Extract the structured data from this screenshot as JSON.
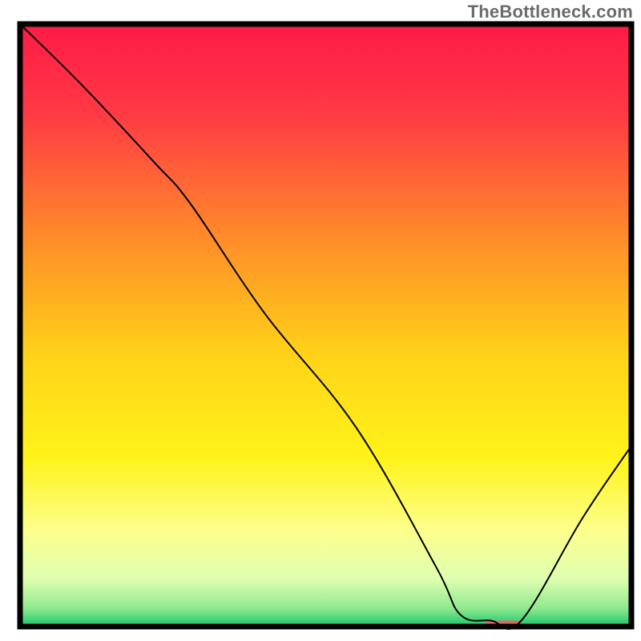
{
  "watermark": "TheBottleneck.com",
  "chart_data": {
    "type": "line",
    "title": "",
    "xlabel": "",
    "ylabel": "",
    "xlim": [
      0,
      100
    ],
    "ylim": [
      0,
      100
    ],
    "grid": false,
    "legend": false,
    "background_gradient_stops": [
      {
        "offset": 0.0,
        "color": "#ff1a48"
      },
      {
        "offset": 0.15,
        "color": "#ff3a44"
      },
      {
        "offset": 0.35,
        "color": "#ff8a2a"
      },
      {
        "offset": 0.55,
        "color": "#ffd318"
      },
      {
        "offset": 0.72,
        "color": "#fff31a"
      },
      {
        "offset": 0.84,
        "color": "#fdff8c"
      },
      {
        "offset": 0.92,
        "color": "#e0ffb0"
      },
      {
        "offset": 0.97,
        "color": "#8fe98f"
      },
      {
        "offset": 1.0,
        "color": "#17c56a"
      }
    ],
    "series": [
      {
        "name": "curve",
        "color": "#000000",
        "stroke_width": 2,
        "x": [
          0,
          10,
          22,
          28,
          40,
          55,
          68,
          72,
          77,
          82,
          92,
          100
        ],
        "values": [
          100,
          90,
          77,
          70,
          52,
          33,
          10,
          2,
          1,
          1,
          18,
          30
        ]
      }
    ],
    "marker": {
      "name": "optimum-marker",
      "x_center": 79,
      "width_pct": 6,
      "y_baseline": 0.4,
      "height_pct": 1.2,
      "color": "#e06666",
      "radius_px": 5
    }
  }
}
